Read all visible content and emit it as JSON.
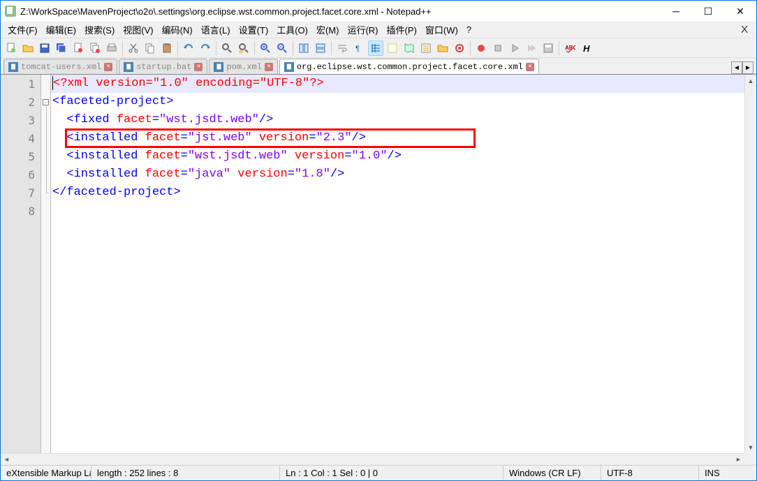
{
  "window": {
    "title": "Z:\\WorkSpace\\MavenProject\\o2o\\.settings\\org.eclipse.wst.common.project.facet.core.xml - Notepad++"
  },
  "menu": {
    "items": [
      "文件(F)",
      "编辑(E)",
      "搜索(S)",
      "视图(V)",
      "编码(N)",
      "语言(L)",
      "设置(T)",
      "工具(O)",
      "宏(M)",
      "运行(R)",
      "插件(P)",
      "窗口(W)",
      "?"
    ]
  },
  "tabs": [
    {
      "label": "tomcat-users.xml",
      "active": false
    },
    {
      "label": "startup.bat",
      "active": false
    },
    {
      "label": "pom.xml",
      "active": false
    },
    {
      "label": "org.eclipse.wst.common.project.facet.core.xml",
      "active": true
    }
  ],
  "lines": [
    "1",
    "2",
    "3",
    "4",
    "5",
    "6",
    "7",
    "8"
  ],
  "code": {
    "l1": {
      "a": "<?",
      "b": "xml ",
      "c": "version",
      "d": "=",
      "e": "\"1.0\"",
      "f": " ",
      "g": "encoding",
      "h": "=",
      "i": "\"UTF-8\"",
      "j": "?>"
    },
    "l2": {
      "a": "<",
      "b": "faceted-project",
      "c": ">"
    },
    "l3": {
      "a": "  <",
      "b": "fixed ",
      "c": "facet",
      "d": "=",
      "e": "\"wst.jsdt.web\"",
      "f": "/>"
    },
    "l4": {
      "a": "  <",
      "b": "installed ",
      "c": "facet",
      "d": "=",
      "e": "\"jst.web\"",
      "f": " ",
      "g": "version",
      "h": "=",
      "i": "\"2.3\"",
      "j": "/>"
    },
    "l5": {
      "a": "  <",
      "b": "installed ",
      "c": "facet",
      "d": "=",
      "e": "\"wst.jsdt.web\"",
      "f": " ",
      "g": "version",
      "h": "=",
      "i": "\"1.0\"",
      "j": "/>"
    },
    "l6": {
      "a": "  <",
      "b": "installed ",
      "c": "facet",
      "d": "=",
      "e": "\"java\"",
      "f": " ",
      "g": "version",
      "h": "=",
      "i": "\"1.8\"",
      "j": "/>"
    },
    "l7": {
      "a": "</",
      "b": "faceted-project",
      "c": ">"
    }
  },
  "status": {
    "type": "eXtensible Markup La",
    "length": "length : 252    lines : 8",
    "pos": "Ln : 1    Col : 1    Sel : 0 | 0",
    "eol": "Windows (CR LF)",
    "enc": "UTF-8",
    "mode": "INS"
  }
}
